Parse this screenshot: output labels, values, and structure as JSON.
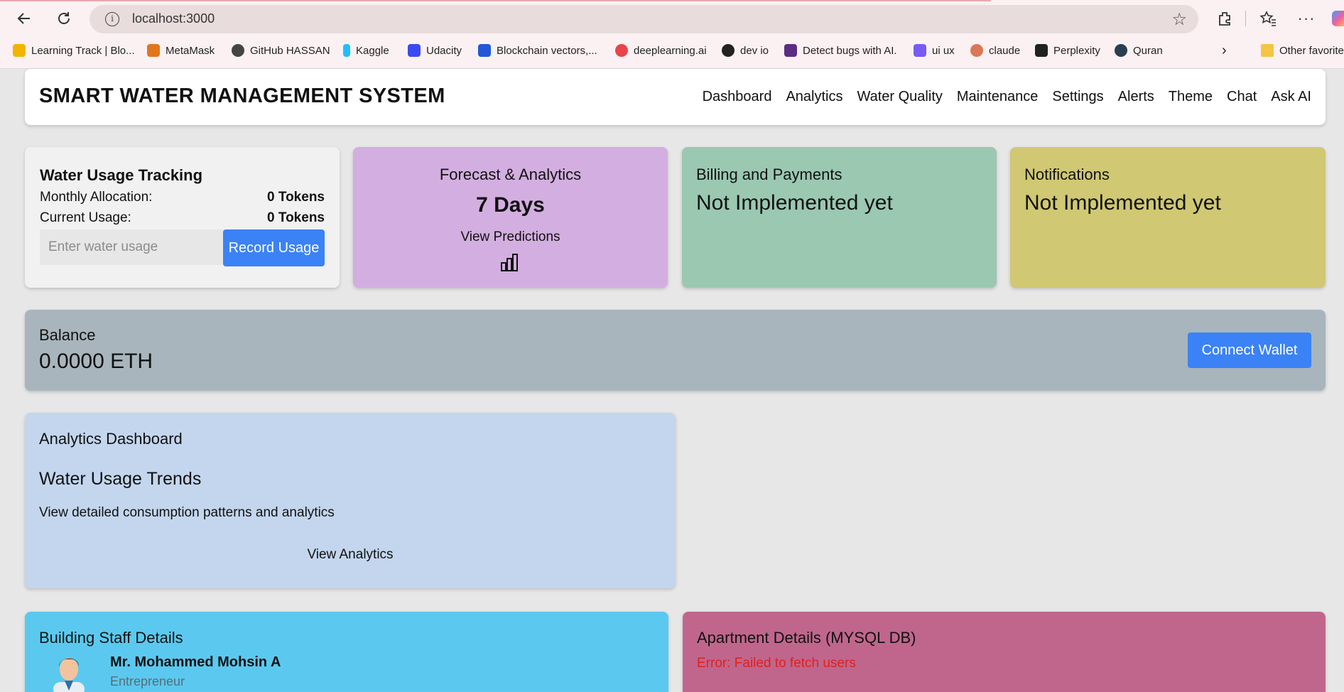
{
  "browser": {
    "url": "localhost:3000",
    "bookmarks": [
      {
        "label": "Learning Track | Blo...",
        "color": "#f2b400"
      },
      {
        "label": "MetaMask",
        "color": "#e2761b"
      },
      {
        "label": "GitHub HASSAN",
        "color": "#444444"
      },
      {
        "label": "Kaggle",
        "color": "#20beff"
      },
      {
        "label": "Udacity",
        "color": "#3b49f4"
      },
      {
        "label": "Blockchain vectors,...",
        "color": "#2058d8"
      },
      {
        "label": "deeplearning.ai",
        "color": "#e8444a"
      },
      {
        "label": "dev io",
        "color": "#222222"
      },
      {
        "label": "Detect bugs with AI.",
        "color": "#5a2d82"
      },
      {
        "label": "ui ux",
        "color": "#7a5af5"
      },
      {
        "label": "claude",
        "color": "#d97757"
      },
      {
        "label": "Perplexity",
        "color": "#202222"
      },
      {
        "label": "Quran",
        "color": "#2a3e52"
      }
    ],
    "other_favorites": "Other favorite"
  },
  "header": {
    "title": "SMART WATER MANAGEMENT SYSTEM",
    "menu": [
      "Dashboard",
      "Analytics",
      "Water Quality",
      "Maintenance",
      "Settings",
      "Alerts",
      "Theme",
      "Chat",
      "Ask AI"
    ]
  },
  "usage": {
    "title": "Water Usage Tracking",
    "monthly_label": "Monthly Allocation:",
    "monthly_value": "0 Tokens",
    "current_label": "Current Usage:",
    "current_value": "0 Tokens",
    "input_placeholder": "Enter water usage",
    "button": "Record Usage"
  },
  "forecast": {
    "title": "Forecast & Analytics",
    "value": "7 Days",
    "link": "View Predictions",
    "icon": "bar-chart-icon"
  },
  "billing": {
    "title": "Billing and Payments",
    "text": "Not Implemented yet"
  },
  "notifications": {
    "title": "Notifications",
    "text": "Not Implemented yet"
  },
  "balance": {
    "title": "Balance",
    "amount": "0.0000 ETH",
    "button": "Connect Wallet"
  },
  "analytics": {
    "title": "Analytics Dashboard",
    "heading": "Water Usage Trends",
    "description": "View detailed consumption patterns and analytics",
    "link": "View Analytics"
  },
  "staff": {
    "title": "Building Staff Details",
    "name": "Mr. Mohammed Mohsin A",
    "role": "Entrepreneur"
  },
  "apartment": {
    "title": "Apartment Details (MYSQL DB)",
    "error": "Error: Failed to fetch users"
  },
  "colors": {
    "accent": "#3b82f6",
    "forecast_bg": "#d3aee0",
    "billing_bg": "#9ac8b1",
    "notifications_bg": "#d0c872",
    "balance_bg": "#a8b5bd",
    "analytics_bg": "#c3d6ee",
    "staff_bg": "#5bc9ef",
    "apartment_bg": "#c0668c",
    "error": "#e02020"
  }
}
